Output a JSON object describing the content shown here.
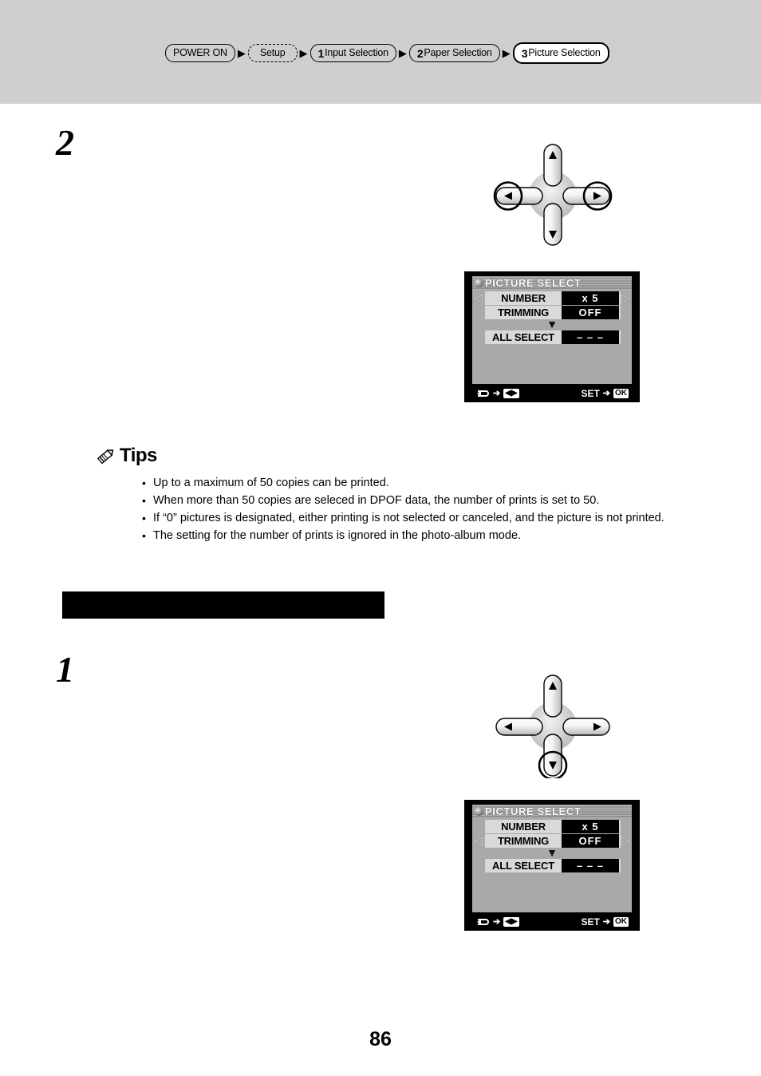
{
  "header": {
    "breadcrumb": [
      {
        "label": "POWER ON",
        "num": "",
        "style": "solid"
      },
      {
        "label": "Setup",
        "num": "",
        "style": "dashed"
      },
      {
        "label": "Input Selection",
        "num": "1",
        "style": "solid"
      },
      {
        "label": "Paper Selection",
        "num": "2",
        "style": "solid"
      },
      {
        "label": "Picture Selection",
        "num": "3",
        "style": "active"
      }
    ],
    "arrow": "▶",
    "band_color": "#cfcfcf"
  },
  "steps": {
    "step_two": "2",
    "step_one": "1"
  },
  "dpad_top": {
    "up": "▲",
    "down": "▼",
    "left": "◀",
    "right": "▶",
    "highlight": [
      "left",
      "right"
    ]
  },
  "dpad_bottom": {
    "up": "▲",
    "down": "▼",
    "left": "◀",
    "right": "▶",
    "highlight": [
      "down"
    ]
  },
  "lcd_top": {
    "title": "PICTURE SELECT",
    "rows": [
      {
        "label": "NUMBER",
        "value": "x  5",
        "selected": true
      },
      {
        "label": "TRIMMING",
        "value": "OFF",
        "selected": false
      }
    ],
    "separator": "▼",
    "all_select": {
      "label": "ALL SELECT",
      "value": "– – –"
    },
    "hint_left_label": "",
    "hint_left_icon": "cycle-icon",
    "hint_left_chip": "◀▶",
    "hint_right_label": "SET",
    "hint_right_chip": "OK",
    "hint_arrow": "➔",
    "selection_arrow_left": "◁",
    "selection_arrow_right": "▷"
  },
  "lcd_bottom": {
    "title": "PICTURE SELECT",
    "rows": [
      {
        "label": "NUMBER",
        "value": "x  5",
        "selected": false
      },
      {
        "label": "TRIMMING",
        "value": "OFF",
        "selected": true
      }
    ],
    "separator": "▼",
    "all_select": {
      "label": "ALL SELECT",
      "value": "– – –"
    },
    "hint_left_label": "",
    "hint_left_icon": "cycle-icon",
    "hint_left_chip": "◀▶",
    "hint_right_label": "SET",
    "hint_right_chip": "OK",
    "hint_arrow": "➔",
    "selection_arrow_left": "◁",
    "selection_arrow_right": "▷"
  },
  "tips": {
    "title": "Tips",
    "icon": "pencil-icon",
    "items": [
      "Up to a maximum of 50 copies can be printed.",
      "When more than 50 copies are seleced in DPOF data, the number of prints is set to 50.",
      "If “0” pictures is designated, either printing is not selected or canceled, and the picture is not printed.",
      "The setting for the number of prints is ignored in the photo-album mode."
    ]
  },
  "section_bar": {
    "text": "",
    "color": "#000000"
  },
  "footer": {
    "page_number": "86"
  }
}
